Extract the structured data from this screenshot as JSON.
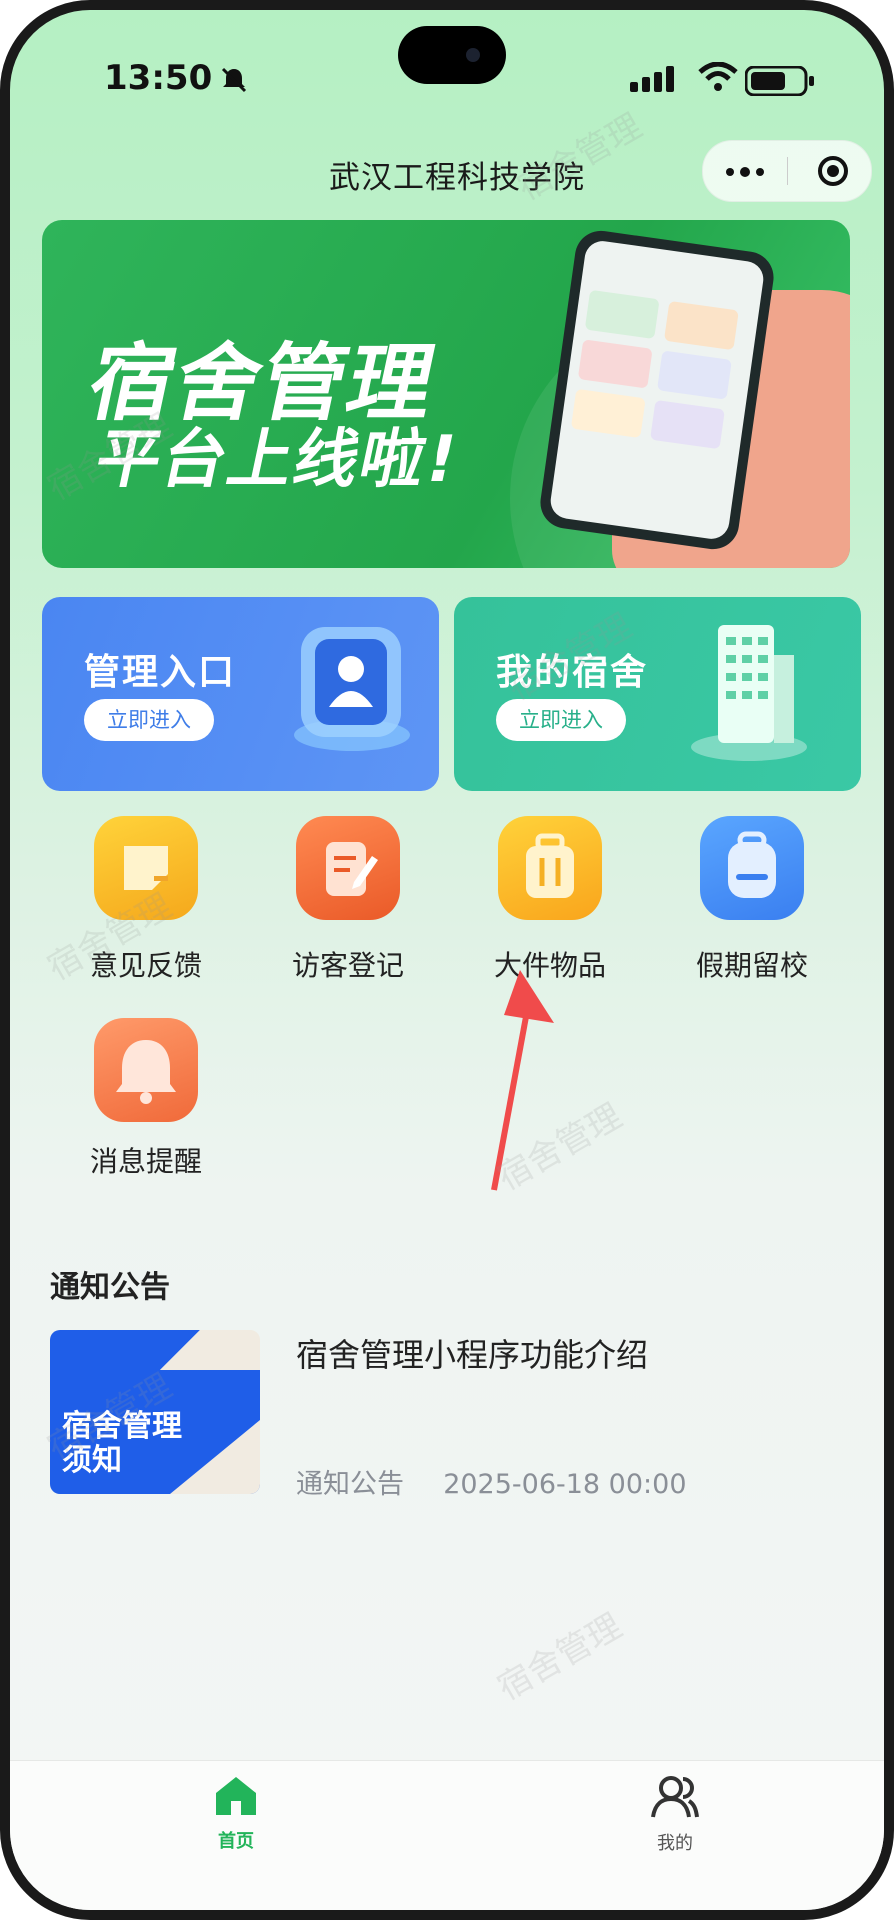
{
  "status_bar": {
    "time": "13:50"
  },
  "app": {
    "title": "武汉工程科技学院"
  },
  "banner": {
    "line1": "宿舍管理",
    "line2": "平台上线啦!"
  },
  "entries": [
    {
      "title": "管理入口",
      "button": "立即进入",
      "icon": "id-badge-icon",
      "color": "#4a86f2"
    },
    {
      "title": "我的宿舍",
      "button": "立即进入",
      "icon": "building-icon",
      "color": "#35c29a"
    }
  ],
  "grid": [
    {
      "label": "意见反馈",
      "icon": "feedback-icon",
      "color": "#f7b523"
    },
    {
      "label": "访客登记",
      "icon": "visitor-register-icon",
      "color": "#f36a3c"
    },
    {
      "label": "大件物品",
      "icon": "luggage-icon",
      "color": "#f9b623"
    },
    {
      "label": "假期留校",
      "icon": "backpack-icon",
      "color": "#4a8ff5"
    },
    {
      "label": "消息提醒",
      "icon": "bell-icon",
      "color": "#f5764b"
    }
  ],
  "notice": {
    "section_title": "通知公告",
    "item_title": "宿舍管理小程序功能介绍",
    "item_category": "通知公告",
    "item_time": "2025-06-18 00:00",
    "thumb_text_1": "宿舍管理",
    "thumb_text_2": "须知"
  },
  "tabbar": [
    {
      "label": "首页",
      "icon": "home-icon",
      "active": true,
      "color": "#22b45a"
    },
    {
      "label": "我的",
      "icon": "user-icon",
      "active": false,
      "color": "#333333"
    }
  ],
  "watermark": "宿舍管理"
}
